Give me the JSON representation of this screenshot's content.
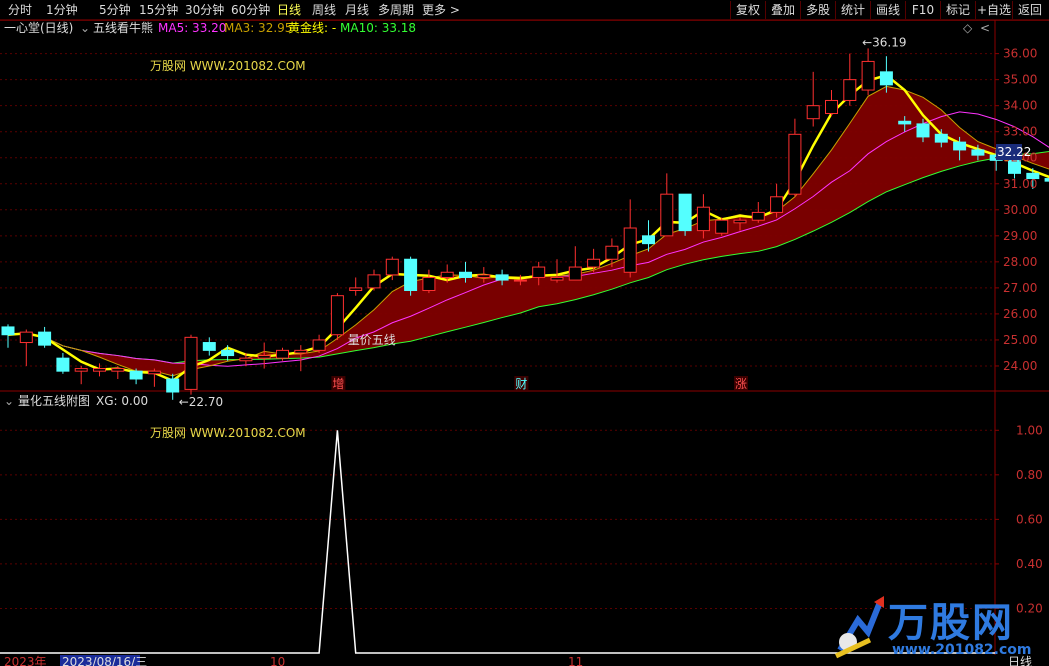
{
  "toolbar": {
    "tabs": [
      "分时",
      "1分钟",
      "5分钟",
      "15分钟",
      "30分钟",
      "60分钟",
      "日线",
      "周线",
      "月线",
      "多周期",
      "更多"
    ],
    "more_arrow": ">",
    "right_buttons": [
      "复权",
      "叠加",
      "多股",
      "统计",
      "画线",
      "F10",
      "标记",
      "+自选",
      "返回"
    ]
  },
  "legend": {
    "stock": "一心堂(日线)",
    "indicator": "五线看牛熊",
    "ma5": "MA5: 33.20",
    "ma3": "MA3: 32.95",
    "gold": "黄金线: -",
    "ma10": "MA10: 33.18"
  },
  "watermark": "万股网 WWW.201082.COM",
  "annotations": {
    "high": "36.19",
    "low": "22.70",
    "line_label": "量价五线",
    "markers": [
      "增",
      "财",
      "涨"
    ]
  },
  "price_tag": "32.22",
  "sub": {
    "title": "量化五线附图",
    "xg": "XG: 0.00",
    "yticks": [
      "1.00",
      "0.80",
      "0.60",
      "0.40",
      "0.20"
    ]
  },
  "bottom": {
    "year": "2023年",
    "date": "2023/08/16/三",
    "month10": "10",
    "month11": "11",
    "period": "日线"
  },
  "logo": {
    "name": "万股网",
    "url": "www.201082.com"
  },
  "colors": {
    "up": "#ff3030",
    "down": "#54ffff",
    "ribbon": "#800000",
    "ma5": "#ff33ff",
    "ma3": "#c8a000",
    "gold": "#ffff00",
    "ma10": "#33ff33"
  },
  "chart_data": {
    "type": "candlestick",
    "ylim": [
      23.0,
      36.6
    ],
    "yticks": [
      24,
      25,
      26,
      27,
      28,
      29,
      30,
      31,
      32,
      33,
      34,
      35,
      36
    ],
    "candles": [
      [
        25.5,
        25.2,
        25.6,
        24.7
      ],
      [
        24.9,
        25.3,
        25.4,
        24.0
      ],
      [
        25.3,
        24.8,
        25.5,
        24.7
      ],
      [
        24.3,
        23.8,
        24.5,
        23.7
      ],
      [
        23.8,
        23.9,
        24.0,
        23.3
      ],
      [
        23.8,
        23.9,
        24.1,
        23.6
      ],
      [
        23.8,
        23.9,
        24.0,
        23.5
      ],
      [
        23.8,
        23.5,
        23.9,
        23.3
      ],
      [
        23.7,
        23.8,
        23.9,
        23.2
      ],
      [
        23.5,
        23.0,
        23.7,
        22.7
      ],
      [
        23.1,
        25.1,
        25.2,
        22.9
      ],
      [
        24.9,
        24.6,
        25.1,
        24.4
      ],
      [
        24.6,
        24.4,
        24.8,
        24.2
      ],
      [
        24.2,
        24.3,
        24.5,
        24.0
      ],
      [
        24.3,
        24.4,
        24.9,
        23.9
      ],
      [
        24.3,
        24.6,
        24.7,
        24.2
      ],
      [
        24.5,
        24.6,
        24.8,
        23.8
      ],
      [
        24.6,
        25.0,
        25.2,
        24.5
      ],
      [
        25.2,
        26.7,
        26.8,
        25.0
      ],
      [
        26.9,
        27.0,
        27.4,
        26.7
      ],
      [
        27.0,
        27.5,
        27.7,
        26.9
      ],
      [
        27.5,
        28.1,
        28.2,
        27.3
      ],
      [
        28.1,
        26.9,
        28.2,
        26.7
      ],
      [
        26.9,
        27.4,
        27.7,
        26.8
      ],
      [
        27.4,
        27.6,
        27.9,
        27.2
      ],
      [
        27.6,
        27.4,
        28.0,
        27.2
      ],
      [
        27.4,
        27.5,
        27.8,
        27.2
      ],
      [
        27.5,
        27.3,
        27.7,
        27.1
      ],
      [
        27.3,
        27.3,
        27.5,
        27.1
      ],
      [
        27.4,
        27.8,
        28.0,
        27.1
      ],
      [
        27.3,
        27.4,
        28.1,
        27.2
      ],
      [
        27.3,
        27.8,
        28.6,
        27.3
      ],
      [
        27.8,
        28.1,
        28.5,
        27.6
      ],
      [
        28.1,
        28.6,
        28.9,
        27.8
      ],
      [
        27.6,
        29.3,
        30.4,
        27.4
      ],
      [
        29.0,
        28.7,
        29.6,
        28.4
      ],
      [
        29.0,
        30.6,
        31.4,
        29.0
      ],
      [
        30.6,
        29.2,
        30.6,
        29.0
      ],
      [
        29.2,
        30.1,
        30.6,
        28.9
      ],
      [
        29.1,
        29.6,
        29.7,
        29.0
      ],
      [
        29.5,
        29.6,
        29.7,
        29.2
      ],
      [
        29.6,
        29.9,
        30.3,
        29.5
      ],
      [
        29.9,
        30.5,
        31.0,
        29.7
      ],
      [
        30.6,
        32.9,
        33.5,
        30.5
      ],
      [
        33.5,
        34.0,
        35.3,
        33.2
      ],
      [
        33.7,
        34.2,
        34.6,
        33.6
      ],
      [
        34.2,
        35.0,
        36.0,
        34.0
      ],
      [
        34.6,
        35.7,
        36.2,
        34.4
      ],
      [
        35.3,
        34.8,
        35.9,
        34.5
      ],
      [
        33.4,
        33.3,
        33.6,
        33.0
      ],
      [
        33.3,
        32.8,
        33.5,
        32.6
      ],
      [
        32.9,
        32.6,
        33.1,
        32.4
      ],
      [
        32.6,
        32.3,
        32.8,
        31.9
      ],
      [
        32.3,
        32.1,
        32.5,
        31.9
      ],
      [
        32.1,
        31.9,
        32.3,
        31.5
      ],
      [
        31.9,
        31.4,
        32.1,
        31.2
      ],
      [
        31.4,
        31.2,
        31.6,
        30.8
      ],
      [
        31.2,
        31.1,
        31.3,
        30.5
      ],
      [
        31.1,
        30.9,
        31.2,
        30.4
      ],
      [
        30.9,
        30.8,
        31.0,
        30.3
      ],
      [
        30.8,
        32.9,
        33.1,
        30.4
      ]
    ],
    "xg_signal": {
      "x_from_index": 19,
      "values": "peak 1.00 at single day, otherwise 0"
    },
    "sub_ylim": [
      0,
      1.1
    ]
  }
}
